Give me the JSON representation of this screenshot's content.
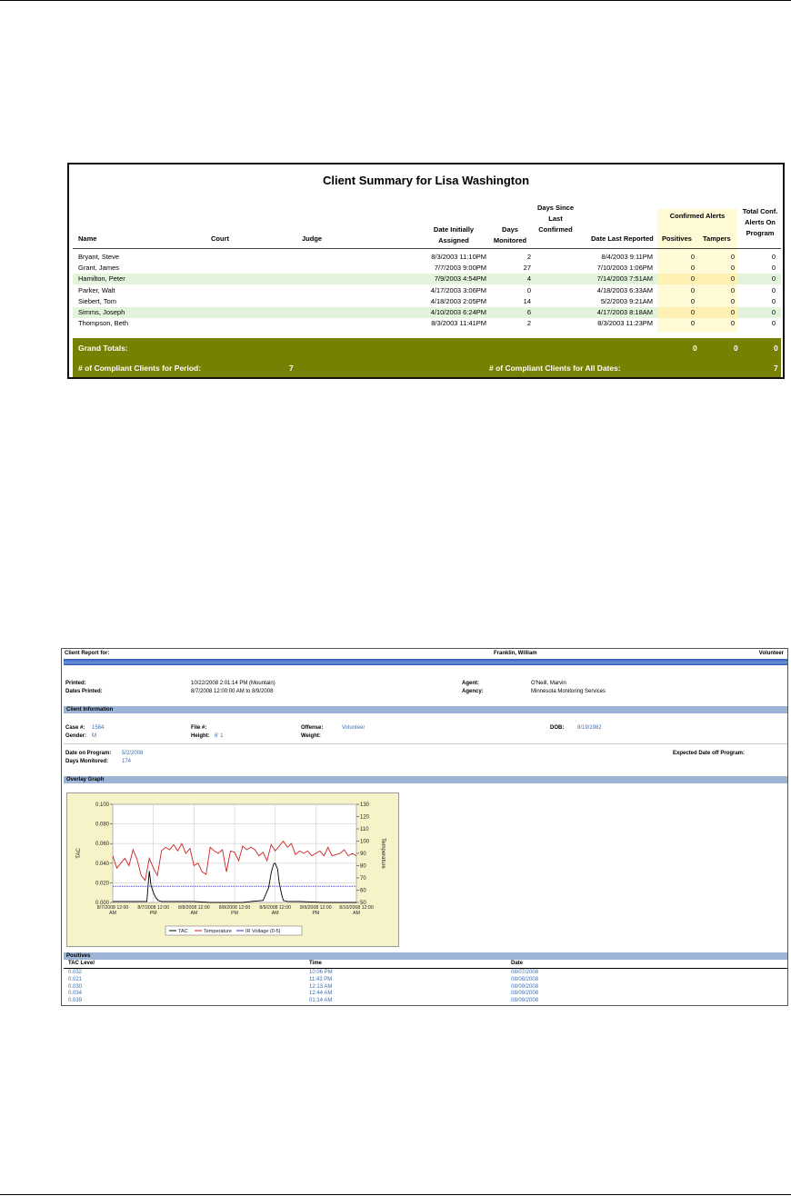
{
  "summary": {
    "title": "Client Summary for Lisa Washington",
    "headers": {
      "name": "Name",
      "court": "Court",
      "judge": "Judge",
      "date_assigned": [
        "Date Initially",
        "Assigned"
      ],
      "days_monitored": [
        "Days",
        "Monitored"
      ],
      "days_since": [
        "Days Since",
        "Last",
        "Confirmed"
      ],
      "date_last": "Date Last Reported",
      "confirmed_alerts": "Confirmed Alerts",
      "positives": "Positives",
      "tampers": "Tampers",
      "total_conf": [
        "Total Conf.",
        "Alerts On",
        "Program"
      ]
    },
    "rows": [
      {
        "name": "Bryant, Steve",
        "assigned": "8/3/2003  11:10PM",
        "days": "2",
        "last": "8/4/2003   9:11PM",
        "positives": "0",
        "tampers": "0",
        "total": "0",
        "highlight": false
      },
      {
        "name": "Grant, James",
        "assigned": "7/7/2003   9:00PM",
        "days": "27",
        "last": "7/10/2003   1:06PM",
        "positives": "0",
        "tampers": "0",
        "total": "0",
        "highlight": false
      },
      {
        "name": "Hamilton, Peter",
        "assigned": "7/9/2003   4:54PM",
        "days": "4",
        "last": "7/14/2003   7:51AM",
        "positives": "0",
        "tampers": "0",
        "total": "0",
        "highlight": true
      },
      {
        "name": "Parker, Walt",
        "assigned": "4/17/2003   3:06PM",
        "days": "0",
        "last": "4/18/2003   6:33AM",
        "positives": "0",
        "tampers": "0",
        "total": "0",
        "highlight": false
      },
      {
        "name": "Siebert, Tom",
        "assigned": "4/18/2003   2:05PM",
        "days": "14",
        "last": "5/2/2003   9:21AM",
        "positives": "0",
        "tampers": "0",
        "total": "0",
        "highlight": false
      },
      {
        "name": "Simms, Joseph",
        "assigned": "4/10/2003   6:24PM",
        "days": "6",
        "last": "4/17/2003   8:18AM",
        "positives": "0",
        "tampers": "0",
        "total": "0",
        "highlight": true
      },
      {
        "name": "Thompson, Beth",
        "assigned": "8/3/2003  11:41PM",
        "days": "2",
        "last": "8/3/2003  11:23PM",
        "positives": "0",
        "tampers": "0",
        "total": "0",
        "highlight": false
      }
    ],
    "totals": {
      "label": "Grand Totals:",
      "positives": "0",
      "tampers": "0",
      "total": "0",
      "compliant_period_label": "# of Compliant Clients for Period:",
      "compliant_period_value": "7",
      "compliant_all_label": "# of Compliant Clients for All Dates:",
      "compliant_all_value": "7"
    }
  },
  "report": {
    "header_label": "Client Report for:",
    "client_name": "Franklin, William",
    "client_type": "Volunteer",
    "printed_label": "Printed:",
    "printed_value": "10/22/2008 2:01:14 PM (Mountain)",
    "dates_printed_label": "Dates Printed:",
    "dates_printed_value": "8/7/2008 12:00:00 AM to 8/9/2008",
    "agent_label": "Agent:",
    "agent_value": "O'Neill, Marvin",
    "agency_label": "Agency:",
    "agency_value": "Minnesota Monitoring Services",
    "client_info_title": "Client Information",
    "case_label": "Case #:",
    "case_value": "1584",
    "gender_label": "Gender:",
    "gender_value": "M",
    "file_label": "File #:",
    "file_value": "",
    "height_label": "Height:",
    "height_value": "6' 1",
    "offense_label": "Offense:",
    "offense_value": "Volunteer",
    "weight_label": "Weight:",
    "weight_value": "",
    "dob_label": "DOB:",
    "dob_value": "8/19/1982",
    "date_on_label": "Date on Program:",
    "date_on_value": "5/2/2008",
    "days_mon_label": "Days Monitored:",
    "days_mon_value": "174",
    "expected_off_label": "Expected Date off Program:",
    "overlay_title": "Overlay Graph",
    "positives_title": "Positives",
    "positives_headers": [
      "TAC Level",
      "Time",
      "Date"
    ],
    "positives": [
      {
        "tac": "0.032",
        "time": "10:06 PM",
        "date": "08/07/2008"
      },
      {
        "tac": "0.021",
        "time": "11:43 PM",
        "date": "08/08/2008"
      },
      {
        "tac": "0.030",
        "time": "12:13 AM",
        "date": "08/09/2008"
      },
      {
        "tac": "0.034",
        "time": "12:44 AM",
        "date": "08/09/2008"
      },
      {
        "tac": "0.039",
        "time": "01:14 AM",
        "date": "08/09/2008"
      }
    ]
  },
  "chart_data": {
    "type": "line",
    "title": "",
    "ylabel": "TAC",
    "y2label": "Temperature",
    "ylim": [
      0,
      0.1
    ],
    "y2lim": [
      50,
      130
    ],
    "yticks": [
      "0.000",
      "0.020",
      "0.040",
      "0.060",
      "0.080",
      "0.100"
    ],
    "y2ticks": [
      "50",
      "60",
      "70",
      "80",
      "90",
      "100",
      "110",
      "120",
      "130"
    ],
    "xlim": [
      0,
      3
    ],
    "xticks": [
      {
        "x": 0,
        "label": [
          "8/7/2008 12:00",
          "AM"
        ]
      },
      {
        "x": 0.5,
        "label": [
          "8/7/2008 12:00",
          "PM"
        ]
      },
      {
        "x": 1,
        "label": [
          "8/8/2008 12:00",
          "AM"
        ]
      },
      {
        "x": 1.5,
        "label": [
          "8/8/2008 12:00",
          "PM"
        ]
      },
      {
        "x": 2,
        "label": [
          "8/9/2008 12:00",
          "AM"
        ]
      },
      {
        "x": 2.5,
        "label": [
          "8/9/2008 12:00",
          "PM"
        ]
      },
      {
        "x": 3,
        "label": [
          "8/10/2008 12:00",
          "AM"
        ]
      }
    ],
    "grid": true,
    "legend_position": "bottom",
    "series": [
      {
        "name": "TAC",
        "axis": "left",
        "color": "#000000",
        "x": [
          0,
          0.3,
          0.42,
          0.45,
          0.47,
          0.5,
          0.53,
          0.56,
          0.6,
          0.8,
          1.0,
          1.2,
          1.35,
          1.6,
          1.7,
          1.85,
          1.92,
          1.95,
          1.98,
          2.0,
          2.03,
          2.05,
          2.08,
          2.1,
          2.15,
          2.3,
          2.6,
          3.0
        ],
        "y": [
          0.001,
          0.001,
          0.001,
          0.032,
          0.018,
          0.01,
          0.005,
          0.002,
          0.001,
          0.001,
          0.001,
          0.0,
          0.0,
          0.0,
          0.001,
          0.002,
          0.015,
          0.03,
          0.039,
          0.04,
          0.034,
          0.02,
          0.008,
          0.002,
          0.001,
          0.001,
          0.0,
          0.0
        ]
      },
      {
        "name": "Temperature",
        "axis": "right",
        "color": "#cc2222",
        "x": [
          0,
          0.05,
          0.1,
          0.15,
          0.2,
          0.25,
          0.3,
          0.35,
          0.4,
          0.45,
          0.5,
          0.55,
          0.6,
          0.65,
          0.7,
          0.75,
          0.8,
          0.85,
          0.9,
          0.95,
          1.0,
          1.05,
          1.1,
          1.15,
          1.2,
          1.25,
          1.3,
          1.35,
          1.4,
          1.45,
          1.5,
          1.55,
          1.6,
          1.65,
          1.7,
          1.75,
          1.8,
          1.85,
          1.9,
          1.95,
          2.0,
          2.05,
          2.1,
          2.15,
          2.2,
          2.25,
          2.3,
          2.35,
          2.4,
          2.45,
          2.5,
          2.55,
          2.6,
          2.65,
          2.7,
          2.75,
          2.8,
          2.85,
          2.9,
          2.95,
          3.0
        ],
        "y": [
          88,
          78,
          82,
          86,
          80,
          93,
          85,
          72,
          68,
          86,
          78,
          72,
          92,
          95,
          93,
          97,
          92,
          98,
          90,
          94,
          80,
          82,
          75,
          73,
          95,
          92,
          90,
          93,
          75,
          92,
          91,
          84,
          96,
          93,
          95,
          93,
          88,
          91,
          84,
          97,
          92,
          96,
          100,
          95,
          98,
          89,
          92,
          90,
          92,
          88,
          90,
          92,
          88,
          95,
          88,
          89,
          90,
          93,
          88,
          90,
          88
        ]
      },
      {
        "name": "IR Voltage (0-5)",
        "axis": "left",
        "color": "#3333cc",
        "x": [
          0,
          3
        ],
        "y": [
          0.0165,
          0.0165
        ]
      }
    ]
  }
}
